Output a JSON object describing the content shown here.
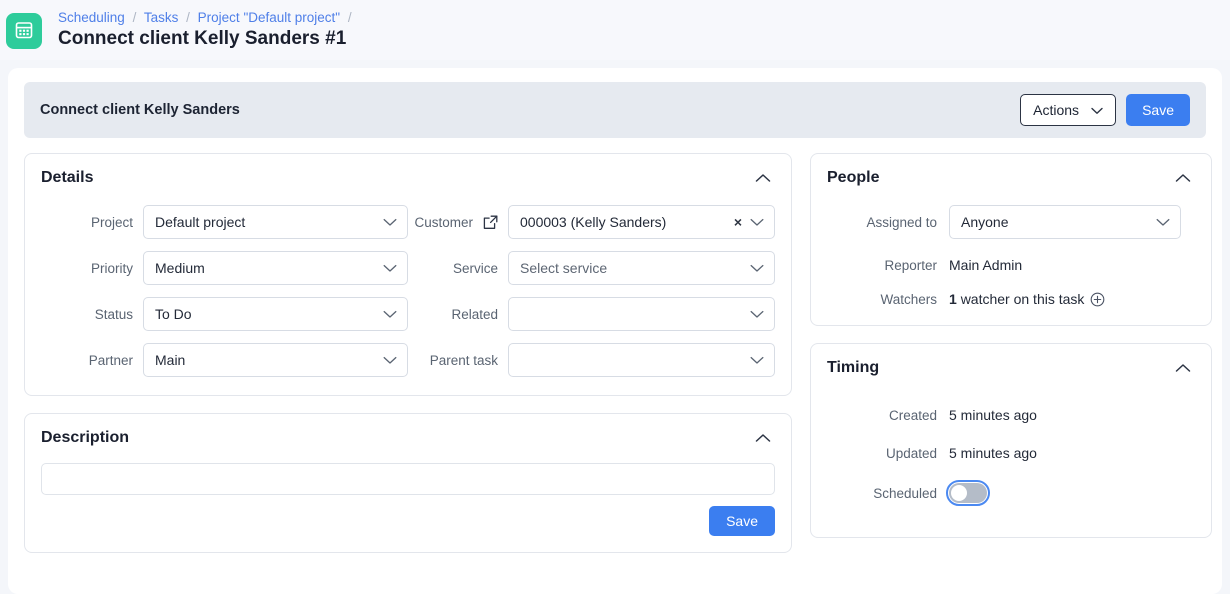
{
  "topbar": {
    "logo_icon": "calendar-icon",
    "breadcrumb": [
      {
        "label": "Scheduling",
        "link": true
      },
      {
        "label": "Tasks",
        "link": true
      },
      {
        "label": "Project \"Default project\"",
        "link": true
      }
    ],
    "separator": "/",
    "page_title": "Connect client Kelly Sanders #1"
  },
  "task_header": {
    "title": "Connect client Kelly Sanders",
    "actions_label": "Actions",
    "actions_icon": "chevron-down-icon",
    "save_label": "Save"
  },
  "details": {
    "title": "Details",
    "collapse_icon": "chevron-up-icon",
    "left_fields": [
      {
        "label": "Project",
        "value": "Default project",
        "placeholder": false
      },
      {
        "label": "Priority",
        "value": "Medium",
        "placeholder": false
      },
      {
        "label": "Status",
        "value": "To Do",
        "placeholder": false
      },
      {
        "label": "Partner",
        "value": "Main",
        "placeholder": false
      }
    ],
    "right_fields": [
      {
        "label": "Customer",
        "value": "000003 (Kelly Sanders)",
        "placeholder": false,
        "clearable": true,
        "external_link": true
      },
      {
        "label": "Service",
        "value": "Select service",
        "placeholder": true,
        "clearable": false,
        "external_link": false
      },
      {
        "label": "Related",
        "value": "",
        "placeholder": false,
        "clearable": false,
        "external_link": false
      },
      {
        "label": "Parent task",
        "value": "",
        "placeholder": false,
        "clearable": false,
        "external_link": false
      }
    ]
  },
  "description": {
    "title": "Description",
    "collapse_icon": "chevron-up-icon",
    "input_value": "",
    "input_placeholder": "",
    "save_label": "Save"
  },
  "people": {
    "title": "People",
    "collapse_icon": "chevron-up-icon",
    "assigned_to_label": "Assigned to",
    "assigned_to_value": "Anyone",
    "reporter_label": "Reporter",
    "reporter_value": "Main Admin",
    "watchers_label": "Watchers",
    "watchers_count": "1",
    "watchers_text": "watcher on this task",
    "watchers_add_icon": "circle-plus-icon"
  },
  "timing": {
    "title": "Timing",
    "collapse_icon": "chevron-up-icon",
    "created_label": "Created",
    "created_value": "5 minutes ago",
    "updated_label": "Updated",
    "updated_value": "5 minutes ago",
    "scheduled_label": "Scheduled",
    "scheduled_on": false
  },
  "colors": {
    "brand_green": "#2ecc9b",
    "primary_blue": "#3b7ef0",
    "link_blue": "#4f7fe8",
    "header_strip": "#e6eaf0",
    "page_bg": "#f4f6fa"
  }
}
